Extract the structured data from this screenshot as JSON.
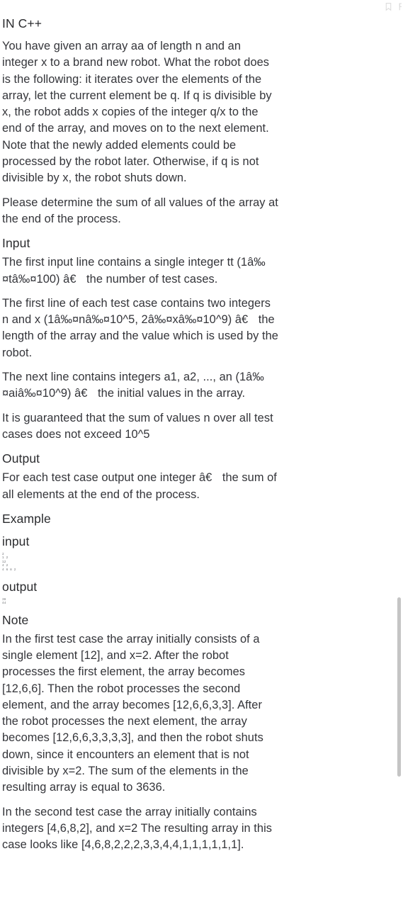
{
  "toolbar": {
    "bookmark_icon": "bookmark-icon",
    "flag_icon": "flag-icon"
  },
  "document": {
    "title_line": "IN C++",
    "intro_paragraphs": [
      "You have given an array aa of length n and an integer x to a brand new robot. What the robot does is the following: it iterates over the elements of the array, let the current element be q. If q is divisible by x, the robot adds x copies of the integer q/x to the end of the array, and moves on to the next element. Note that the newly added elements could be processed by the robot later. Otherwise, if q is not divisible by x, the robot shuts down.",
      "Please determine the sum of all values of the array at the end of the process."
    ],
    "input_heading": "Input",
    "input_paragraphs": [
      "The first input line contains a single integer tt (1â‰¤tâ‰¤100) â€ the number of test cases.",
      "The first line of each test case contains two integers n and x (1â‰¤nâ‰¤10^5, 2â‰¤xâ‰¤10^9) â€ the length of the array and the value which is used by the robot.",
      "The next line contains integers a1, a2, ..., an (1â‰¤aiâ‰¤10^9) â€ the initial values in the array.",
      "It is guaranteed that the sum of values n over all test cases does not exceed 10^5"
    ],
    "output_heading": "Output",
    "output_paragraph": "For each test case output one integer â€ the sum of all elements at the end of the process.",
    "example_heading": "Example",
    "example_input_label": "input",
    "example_input_code": "2\n1 2\n12\n4 2\n4 6 8 2",
    "example_output_label": "output",
    "example_output_code": "36\n44",
    "note_heading": "Note",
    "note_paragraphs": [
      "In the first test case the array initially consists of a single element [12], and x=2. After the robot processes the first element, the array becomes [12,6,6]. Then the robot processes the second element, and the array becomes [12,6,6,3,3]. After the robot processes the next element, the array becomes [12,6,6,3,3,3,3], and then the robot shuts down, since it encounters an element that is not divisible by x=2. The sum of the elements in the resulting array is equal to 3636.",
      "In the second test case the array initially contains integers [4,6,8,2], and x=2 The resulting array in this case looks like [4,6,8,2,2,2,3,3,4,4,1,1,1,1,1,1]."
    ]
  },
  "scrollbar": {
    "thumb_label": "vertical-scrollbar-thumb"
  },
  "colors": {
    "background": "#ffffff",
    "text": "#34353a",
    "heading": "#2b2c2f",
    "code": "#6f7175",
    "scroll_thumb": "#c4c4c4"
  }
}
